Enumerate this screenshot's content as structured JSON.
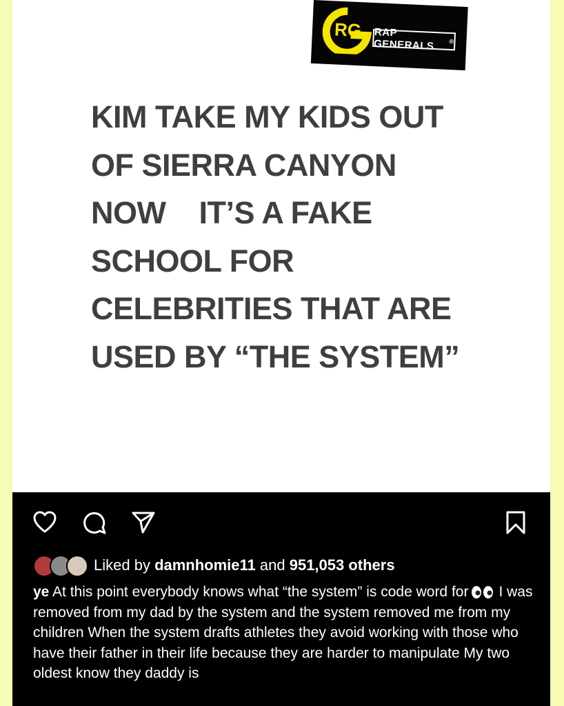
{
  "logo": {
    "monogram": "RG",
    "brand_text": "RAP GENERALS",
    "trademark": "®"
  },
  "post": {
    "headline_lines": [
      "KIM TAKE MY KIDS OUT",
      "OF SIERRA CANYON",
      "NOW    IT’S A FAKE",
      "SCHOOL FOR",
      "CELEBRITIES THAT ARE",
      "USED BY “THE SYSTEM”"
    ]
  },
  "actions": {
    "icons": [
      "heart-icon",
      "comment-icon",
      "share-icon",
      "bookmark-icon"
    ]
  },
  "likes": {
    "prefix": "Liked by ",
    "user": "damnhomie11",
    "connector": " and ",
    "count": "951,053 others"
  },
  "caption": {
    "username": "ye",
    "text_before_emoji": " At this point everybody knows what “the system” is code word for",
    "emoji": "eyes-emoji",
    "text_after_emoji": "I was removed from my dad by the system and the system removed me from my children  When the system drafts athletes they avoid working with those who have their father in their life because they are harder to manipulate  My two oldest know they daddy is"
  },
  "colors": {
    "background_border": "#f8fbb4",
    "headline": "#3f3f3f",
    "logo_yellow": "#f5e400",
    "panel": "#000000"
  }
}
